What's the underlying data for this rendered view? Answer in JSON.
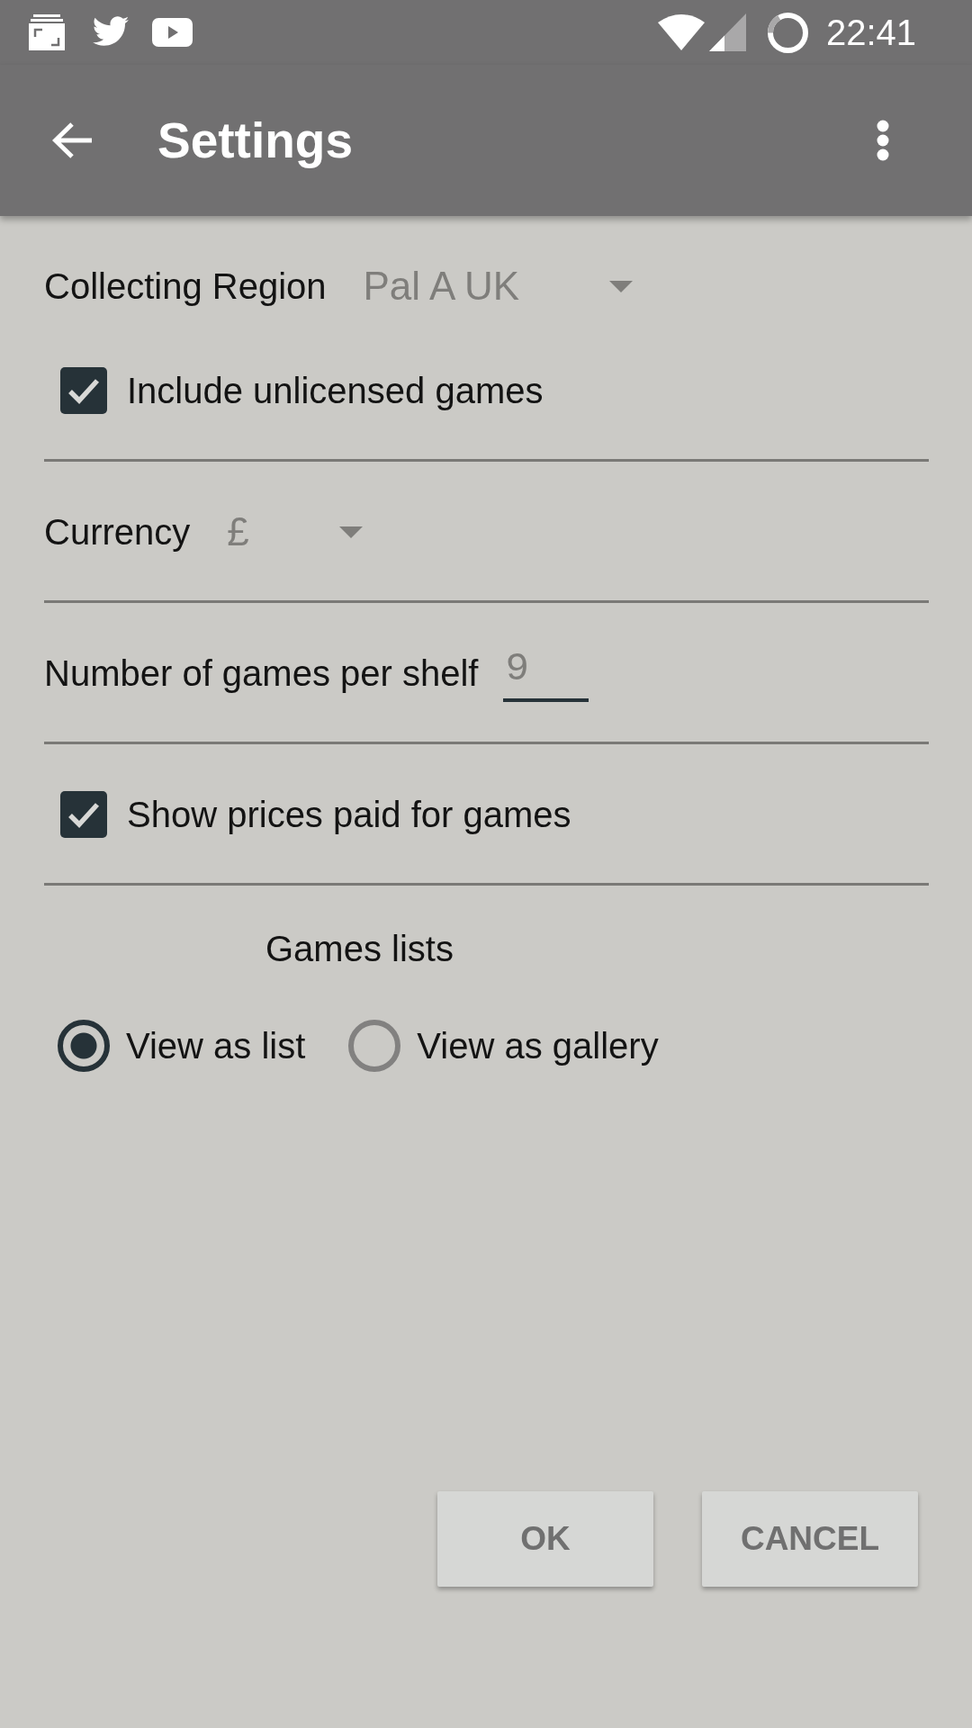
{
  "status_bar": {
    "time": "22:41"
  },
  "app_bar": {
    "title": "Settings"
  },
  "sections": [
    {
      "items": [
        {
          "kind": "dropdown",
          "label": "Collecting Region",
          "value": "Pal A UK"
        },
        {
          "kind": "checkbox",
          "label": "Include unlicensed games",
          "checked": true
        }
      ]
    },
    {
      "items": [
        {
          "kind": "dropdown",
          "label": "Currency",
          "value": "£"
        }
      ]
    },
    {
      "items": [
        {
          "kind": "number",
          "label": "Number of games per shelf",
          "value": "9"
        }
      ]
    },
    {
      "items": [
        {
          "kind": "checkbox",
          "label": "Show prices paid for games",
          "checked": true
        }
      ]
    },
    {
      "items": [
        {
          "kind": "heading",
          "label": "Games lists"
        },
        {
          "kind": "radio_group",
          "options": [
            {
              "label": "View as list",
              "selected": true
            },
            {
              "label": "View as gallery",
              "selected": false
            }
          ]
        }
      ]
    }
  ],
  "buttons": [
    {
      "label": "OK"
    },
    {
      "label": "CANCEL"
    }
  ]
}
